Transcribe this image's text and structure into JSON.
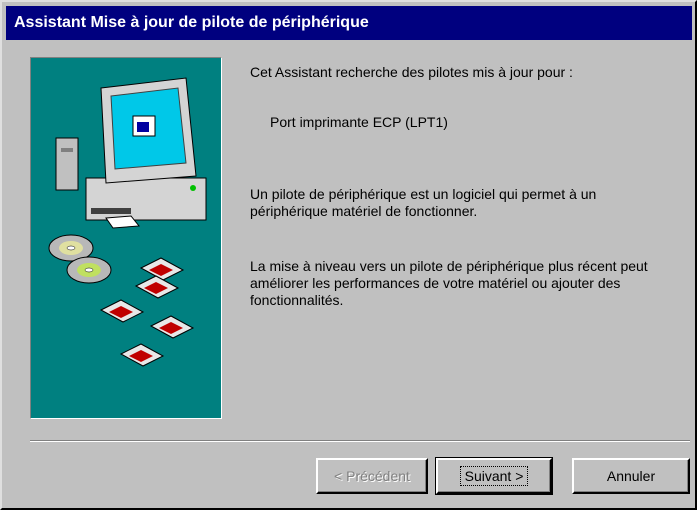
{
  "window": {
    "title": "Assistant Mise à jour de pilote de périphérique"
  },
  "content": {
    "intro": "Cet Assistant recherche des pilotes mis à jour pour :",
    "device_name": "Port imprimante ECP (LPT1)",
    "paragraph_1": "Un pilote de périphérique est un logiciel qui permet à un périphérique matériel de fonctionner.",
    "paragraph_2": "La mise à niveau vers un pilote de périphérique plus récent peut améliorer les performances de votre matériel ou ajouter des fonctionnalités."
  },
  "buttons": {
    "previous": "< Précédent",
    "next": "Suivant >",
    "cancel": "Annuler"
  },
  "states": {
    "previous_enabled": false,
    "default_button": "next"
  },
  "colors": {
    "titlebar": "#00007f",
    "art_background": "#008080",
    "window_face": "#c0c0c0"
  },
  "icons": [
    "computer-icon",
    "cd-disc-icon",
    "floppy-disk-icon"
  ]
}
